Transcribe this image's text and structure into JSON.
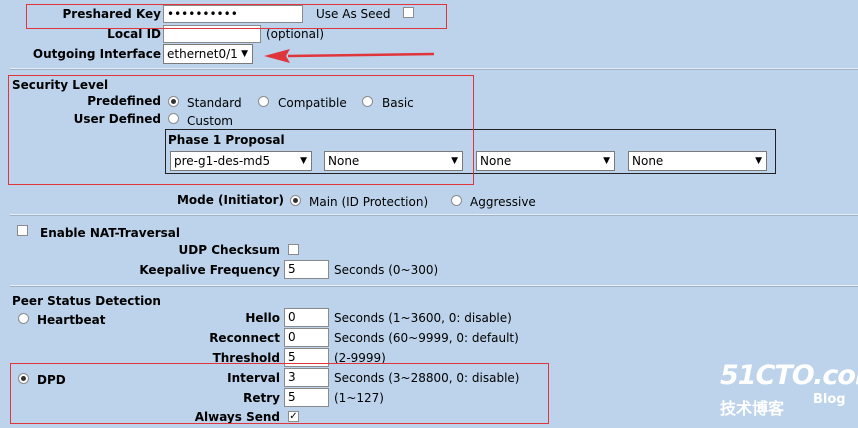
{
  "preshared_key": {
    "label": "Preshared Key",
    "value": "••••••••••",
    "seed_label": "Use As Seed"
  },
  "local_id": {
    "label": "Local ID",
    "value": "",
    "note": "(optional)"
  },
  "outgoing_interface": {
    "label": "Outgoing Interface",
    "value": "ethernet0/1"
  },
  "security": {
    "title": "Security Level",
    "predefined_label": "Predefined",
    "user_defined_label": "User Defined",
    "options": [
      "Standard",
      "Compatible",
      "Basic"
    ],
    "selected": "Standard",
    "custom_label": "Custom",
    "phase1_title": "Phase 1 Proposal",
    "proposals": [
      "pre-g1-des-md5",
      "None",
      "None",
      "None"
    ]
  },
  "mode": {
    "label": "Mode (Initiator)",
    "options": [
      "Main (ID Protection)",
      "Aggressive"
    ],
    "selected": "Main (ID Protection)"
  },
  "nat": {
    "enable_label": "Enable NAT-Traversal",
    "udp_label": "UDP Checksum",
    "keepalive_label": "Keepalive Frequency",
    "keepalive_value": "5",
    "keepalive_unit": "Seconds (0~300)"
  },
  "peer": {
    "title": "Peer Status Detection",
    "heartbeat_label": "Heartbeat",
    "hello_label": "Hello",
    "hello_value": "0",
    "hello_unit": "Seconds (1~3600, 0: disable)",
    "reconnect_label": "Reconnect",
    "reconnect_value": "0",
    "reconnect_unit": "Seconds (60~9999, 0: default)",
    "threshold_label": "Threshold",
    "threshold_value": "5",
    "threshold_unit": "(2-9999)",
    "dpd_label": "DPD",
    "interval_label": "Interval",
    "interval_value": "3",
    "interval_unit": "Seconds (3~28800, 0: disable)",
    "retry_label": "Retry",
    "retry_value": "5",
    "retry_unit": "(1~127)",
    "always_send_label": "Always Send",
    "always_send_checked": true
  },
  "watermark": {
    "brand": "51CTO.com",
    "sub": "技术博客",
    "blog": "Blog"
  },
  "colors": {
    "background": "#bcd3eb",
    "annotation_red": "#e0353b"
  }
}
